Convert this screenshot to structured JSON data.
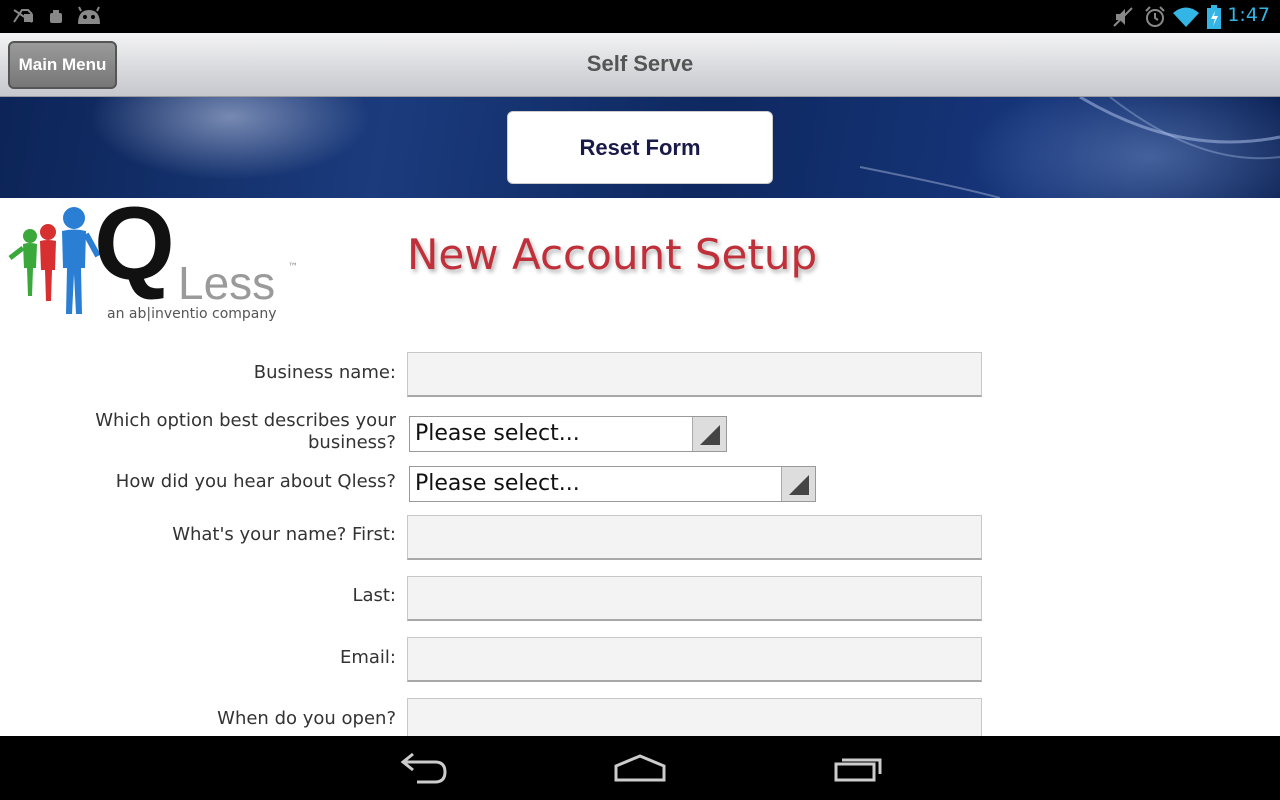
{
  "status_bar": {
    "time": "1:47",
    "left_icons": [
      "notification-off-icon",
      "android-debug-icon",
      "android-icon"
    ],
    "right_icons": [
      "mute-icon",
      "alarm-icon",
      "wifi-icon",
      "battery-icon"
    ],
    "accent_color": "#33b5e5"
  },
  "header": {
    "title": "Self Serve",
    "main_menu_label": "Main Menu"
  },
  "banner": {
    "reset_label": "Reset Form"
  },
  "logo": {
    "q": "Q",
    "less": "Less",
    "tm": "™",
    "tagline": "an ab|inventio company"
  },
  "form": {
    "title": "New Account Setup",
    "title_color": "#c0303a",
    "business_name_label": "Business name:",
    "business_name_value": "",
    "business_type_label_line1": "Which option best describes your",
    "business_type_label_line2": "business?",
    "business_type_value": "Please select...",
    "hear_about_label": "How did you hear about Qless?",
    "hear_about_value": "Please select...",
    "first_name_label": "What's your name? First:",
    "first_name_value": "",
    "last_name_label": "Last:",
    "last_name_value": "",
    "email_label": "Email:",
    "email_value": "",
    "open_label": "When do you open?",
    "open_value": ""
  },
  "nav_bar": {
    "buttons": [
      "back-icon",
      "home-icon",
      "recent-apps-icon"
    ]
  }
}
